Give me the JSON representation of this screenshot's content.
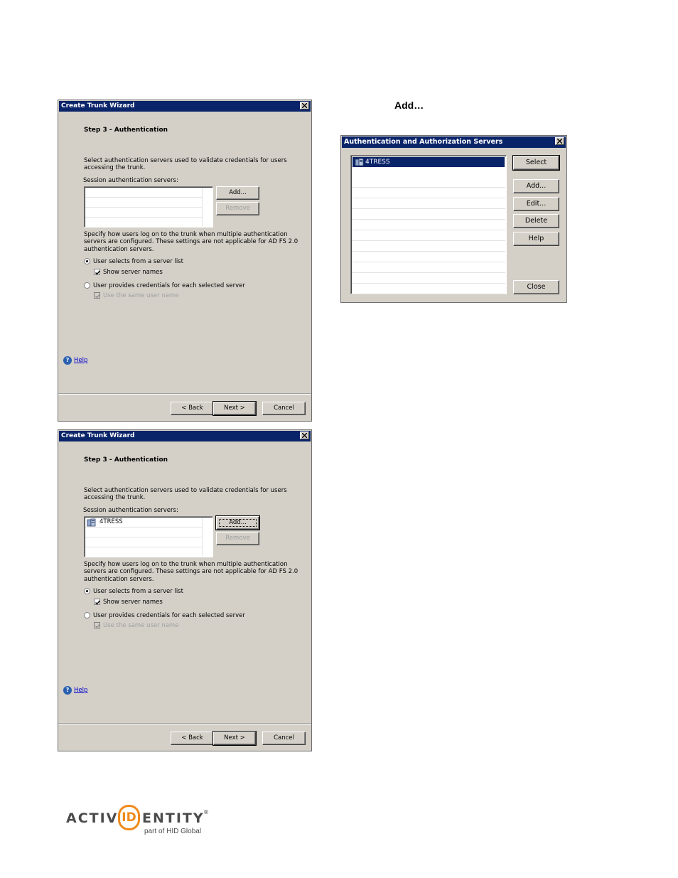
{
  "wizard_title": "Create Trunk Wizard",
  "step_heading": "Step 3 - Authentication",
  "intro_line1": "Select authentication servers used to validate credentials for users",
  "intro_line2": "accessing the trunk.",
  "session_label": "Session authentication servers:",
  "add_label": "Add...",
  "remove_label": "Remove",
  "specify_line1": "Specify how users log on to the trunk when multiple authentication",
  "specify_line2": "servers are configured. These settings are not applicable for AD FS 2.0",
  "specify_line3": "authentication servers.",
  "radio_server_list": "User selects from a server list",
  "check_show_names": "Show server names",
  "radio_each_server": "User provides credentials for each selected server",
  "check_same_user": "Use the same user name",
  "help_label": "Help",
  "back_label": "< Back",
  "next_label": "Next >",
  "cancel_label": "Cancel",
  "instruction_add": "Add…",
  "server_item": "4TRESS",
  "auth_dialog": {
    "title": "Authentication and Authorization Servers",
    "select": "Select",
    "add": "Add...",
    "edit": "Edit...",
    "delete": "Delete",
    "help": "Help",
    "close": "Close"
  },
  "logo": {
    "brand_left": "ACTIV",
    "brand_id": "ID",
    "brand_right": "ENTITY",
    "reg": "®",
    "tagline": "part of HID Global",
    "colors": {
      "gray": "#4b4b4d",
      "orange": "#f08a1c"
    }
  }
}
